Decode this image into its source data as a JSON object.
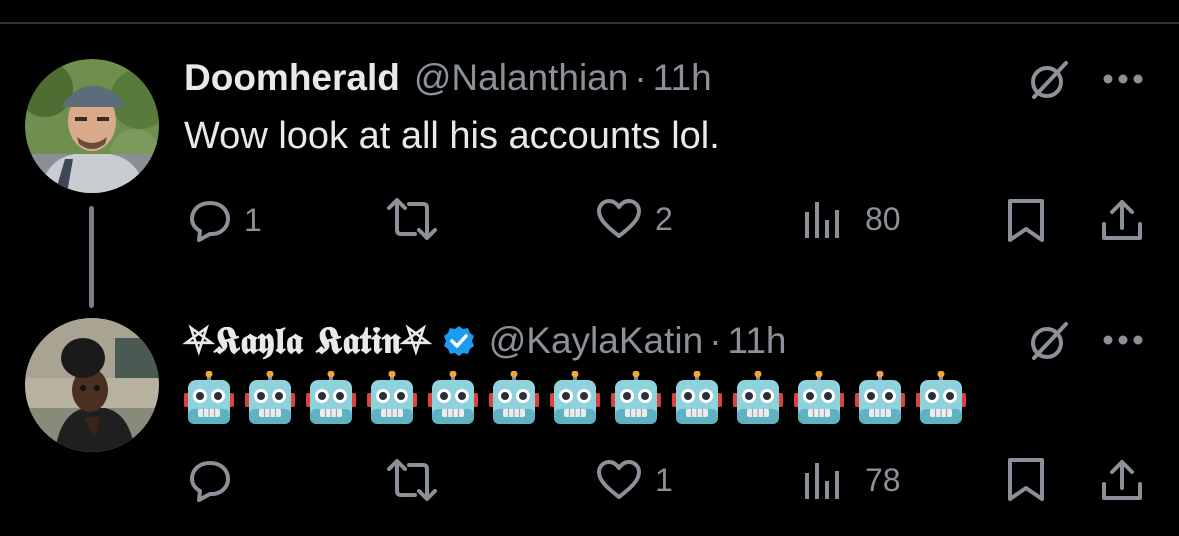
{
  "tweets": [
    {
      "name": "Doomherald",
      "handle": "@Nalanthian",
      "separator": "·",
      "time": "11h",
      "text": "Wow look at all his accounts lol.",
      "verified": false,
      "stats": {
        "replies": "1",
        "likes": "2",
        "views": "80"
      }
    },
    {
      "name": "⛧𝕶𝖆𝖞𝖑𝖆 𝕶𝖆𝖙𝖎𝖓⛧",
      "handle": "@KaylaKatin",
      "separator": "·",
      "time": "11h",
      "emoji_text": "🤖🤖🤖🤖🤖🤖🤖🤖🤖🤖🤖🤖🤖",
      "emoji_icon": "robot-face-emoji",
      "verified": true,
      "stats": {
        "replies": "",
        "likes": "1",
        "views": "78"
      }
    }
  ],
  "colors": {
    "background": "#000000",
    "text": "#e7e9ea",
    "muted": "#8b9198",
    "verified": "#1d9bf0",
    "divider": "#2f3336"
  }
}
